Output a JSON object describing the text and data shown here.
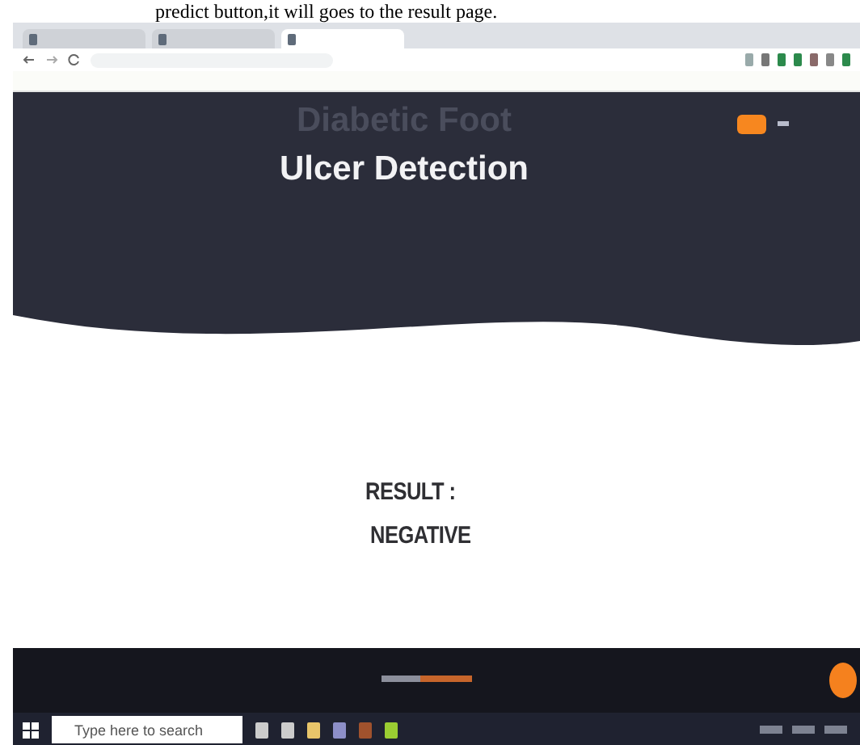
{
  "caption": "predict button,it will goes to the result page.",
  "browser": {
    "tabs": [
      {
        "selected": false
      },
      {
        "selected": false
      },
      {
        "selected": true
      }
    ]
  },
  "header": {
    "title_line_1": "Diabetic Foot",
    "title_line_2": "Ulcer Detection"
  },
  "result": {
    "label": "RESULT :",
    "value": "NEGATIVE"
  },
  "taskbar": {
    "search": {
      "placeholder": "Type here to search"
    }
  }
}
